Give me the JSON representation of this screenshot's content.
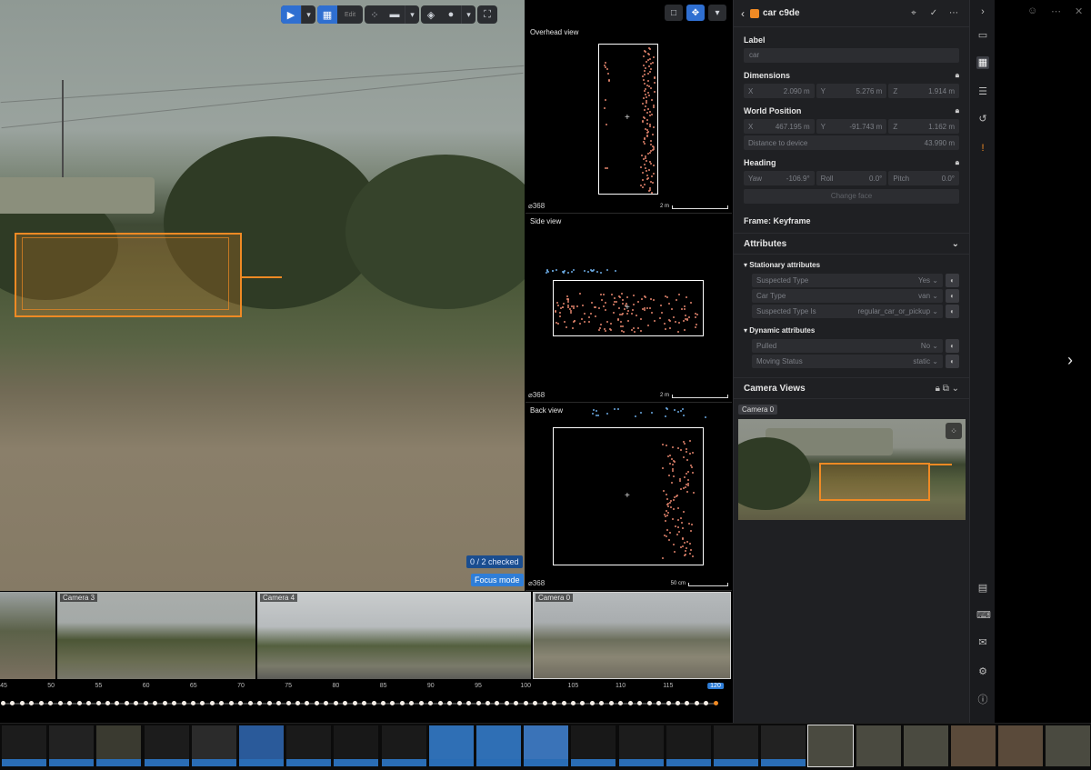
{
  "main_view": {
    "toolbar_label": "Edit",
    "checked_status": "0 / 2 checked",
    "focus_mode_label": "Focus mode"
  },
  "projections": [
    {
      "title": "Overhead view",
      "count": "368",
      "scale": "2 m"
    },
    {
      "title": "Side view",
      "count": "368",
      "scale": "2 m"
    },
    {
      "title": "Back view",
      "count": "368",
      "scale": "50 cm"
    }
  ],
  "panel": {
    "object_title": "car c9de",
    "object_color": "#f08a24",
    "label": {
      "heading": "Label",
      "value": "car"
    },
    "dimensions": {
      "heading": "Dimensions",
      "x_label": "X",
      "x": "2.090 m",
      "y_label": "Y",
      "y": "5.276 m",
      "z_label": "Z",
      "z": "1.914 m"
    },
    "world_position": {
      "heading": "World Position",
      "x_label": "X",
      "x": "467.195 m",
      "y_label": "Y",
      "y": "-91.743 m",
      "z_label": "Z",
      "z": "1.162 m",
      "distance_label": "Distance to device",
      "distance": "43.990 m"
    },
    "heading": {
      "heading": "Heading",
      "yaw_label": "Yaw",
      "yaw": "-106.9°",
      "roll_label": "Roll",
      "roll": "0.0°",
      "pitch_label": "Pitch",
      "pitch": "0.0°",
      "change_face": "Change face"
    },
    "frame_type": "Frame: Keyframe",
    "attributes_title": "Attributes",
    "stationary_title": "Stationary attributes",
    "stationary": [
      {
        "name": "Suspected Type",
        "value": "Yes"
      },
      {
        "name": "Car Type",
        "value": "van"
      },
      {
        "name": "Suspected Type Is",
        "value": "regular_car_or_pickup"
      }
    ],
    "dynamic_title": "Dynamic attributes",
    "dynamic": [
      {
        "name": "Pulled",
        "value": "No"
      },
      {
        "name": "Moving Status",
        "value": "static"
      }
    ],
    "camera_views_title": "Camera Views",
    "camera_tag": "Camera 0"
  },
  "camera_strip": [
    {
      "label": ""
    },
    {
      "label": "Camera 3"
    },
    {
      "label": "Camera 4"
    },
    {
      "label": "Camera 0"
    }
  ],
  "timeline": {
    "ticks": [
      "45",
      "50",
      "55",
      "60",
      "65",
      "70",
      "75",
      "80",
      "85",
      "90",
      "95",
      "100",
      "105",
      "110",
      "115",
      "120"
    ],
    "current": "120"
  },
  "colors": {
    "accent": "#2f7ed8",
    "annotation": "#f08a24",
    "panel_bg": "#1f2023"
  }
}
